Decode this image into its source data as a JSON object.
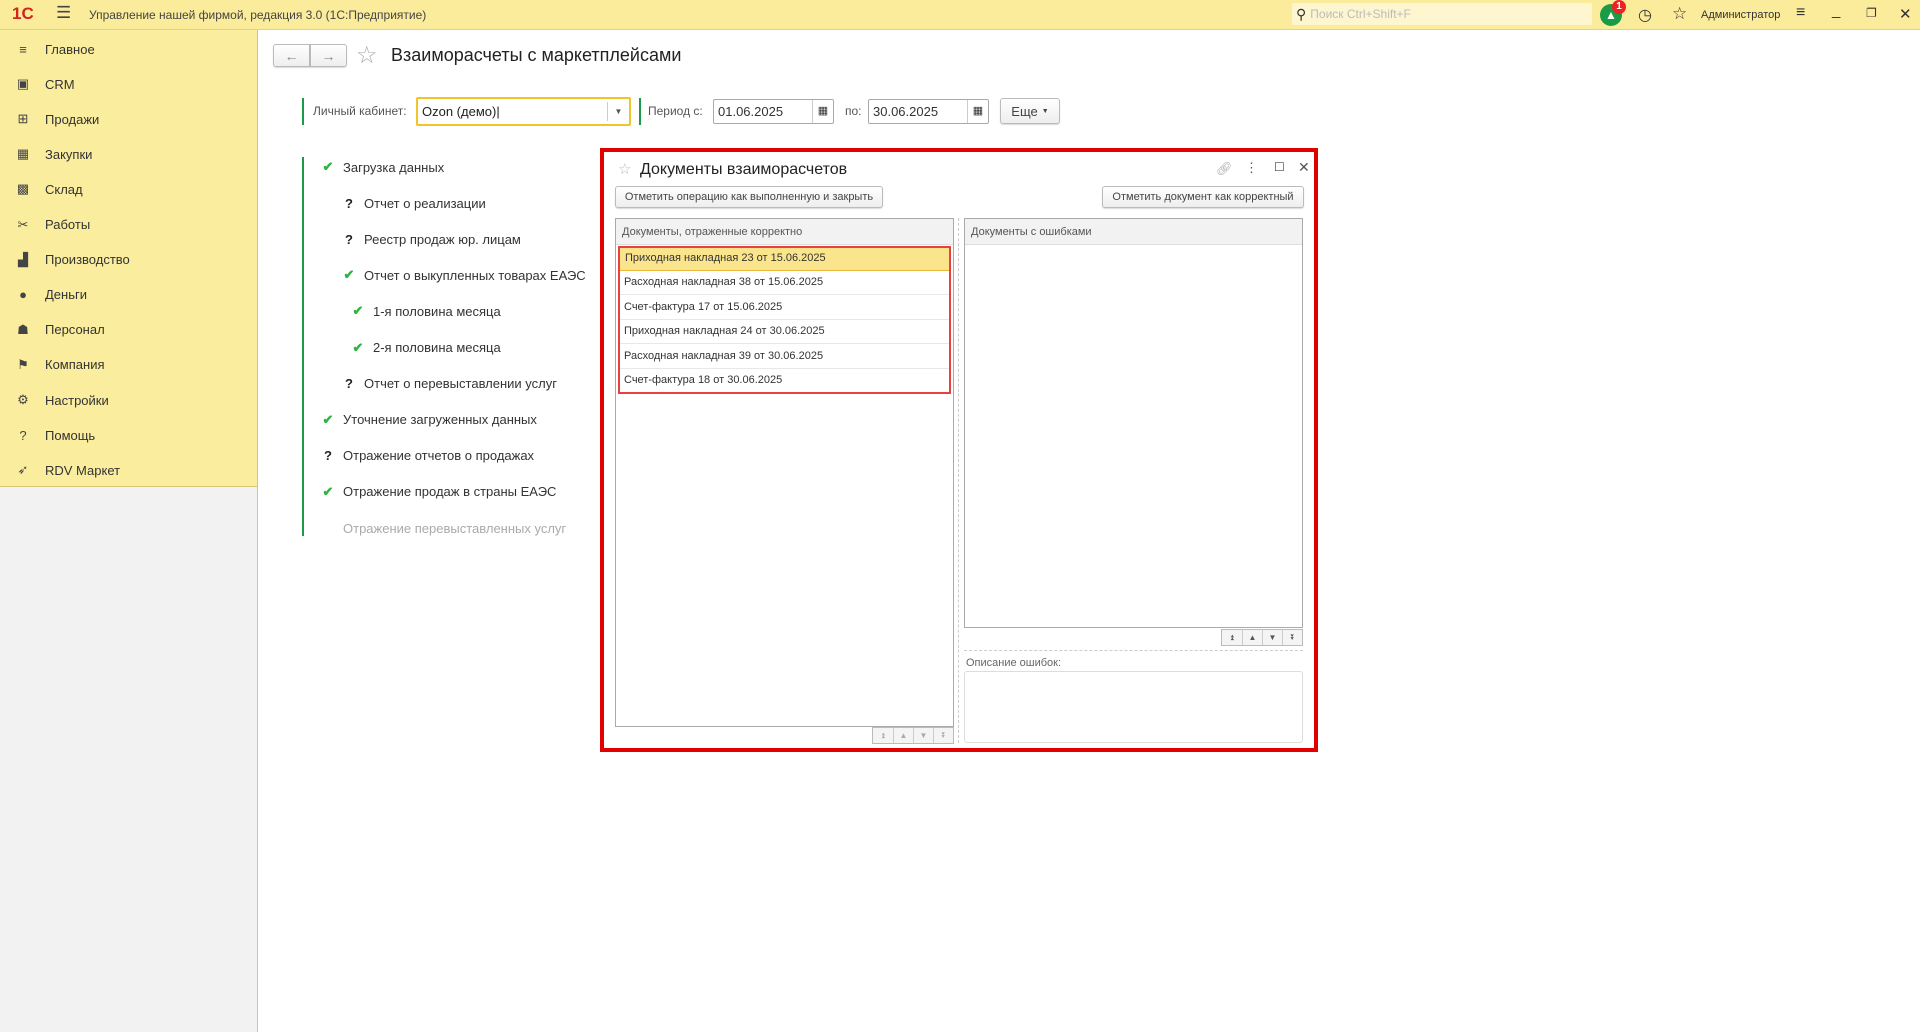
{
  "app": {
    "title": "Управление нашей фирмой, редакция 3.0  (1С:Предприятие)",
    "logo": "1С",
    "search_placeholder": "Поиск Ctrl+Shift+F",
    "notifications": "1",
    "user": "Администратор"
  },
  "sidebar": {
    "items": [
      {
        "label": "Главное",
        "icon": "menu-icon"
      },
      {
        "label": "CRM",
        "icon": "crm-icon"
      },
      {
        "label": "Продажи",
        "icon": "basket-icon"
      },
      {
        "label": "Закупки",
        "icon": "purchases-icon"
      },
      {
        "label": "Склад",
        "icon": "warehouse-icon"
      },
      {
        "label": "Работы",
        "icon": "tools-icon"
      },
      {
        "label": "Производство",
        "icon": "factory-icon"
      },
      {
        "label": "Деньги",
        "icon": "money-icon"
      },
      {
        "label": "Персонал",
        "icon": "people-icon"
      },
      {
        "label": "Компания",
        "icon": "flag-icon"
      },
      {
        "label": "Настройки",
        "icon": "gear-icon"
      },
      {
        "label": "Помощь",
        "icon": "help-icon"
      },
      {
        "label": "RDV Маркет",
        "icon": "rocket-icon"
      }
    ]
  },
  "page": {
    "title": "Взаиморасчеты с маркетплейсами",
    "cabinet_label": "Личный кабинет:",
    "cabinet_value": "Ozon (демо)",
    "period_from_label": "Период с:",
    "period_from": "01.06.2025",
    "period_to_label": "по:",
    "period_to": "30.06.2025",
    "more_label": "Еще"
  },
  "steps": [
    {
      "label": "Загрузка данных",
      "status": "done",
      "level": 0
    },
    {
      "label": "Отчет о реализации",
      "status": "unknown",
      "level": 1
    },
    {
      "label": "Реестр продаж юр. лицам",
      "status": "unknown",
      "level": 1
    },
    {
      "label": "Отчет о выкупленных товарах ЕАЭС",
      "status": "done",
      "level": 1
    },
    {
      "label": "1-я половина месяца",
      "status": "done",
      "level": 2
    },
    {
      "label": "2-я половина месяца",
      "status": "done",
      "level": 2
    },
    {
      "label": "Отчет о перевыставлении услуг",
      "status": "unknown",
      "level": 1
    },
    {
      "label": "Уточнение загруженных данных",
      "status": "done",
      "level": 0
    },
    {
      "label": "Отражение отчетов о продажах",
      "status": "unknown",
      "level": 0
    },
    {
      "label": "Отражение продаж в страны ЕАЭС",
      "status": "done",
      "level": 0
    },
    {
      "label": "Отражение перевыставленных услуг",
      "status": "disabled",
      "level": 0
    }
  ],
  "dialog": {
    "title": "Документы взаиморасчетов",
    "btn_mark_done": "Отметить операцию как выполненную и закрыть",
    "btn_mark_correct": "Отметить документ как корректный",
    "correct_header": "Документы, отраженные корректно",
    "errors_header": "Документы с ошибками",
    "errors_desc_label": "Описание ошибок:",
    "correct_docs": [
      "Приходная накладная 23 от 15.06.2025",
      "Расходная накладная 38 от 15.06.2025",
      "Счет-фактура 17 от 15.06.2025",
      "Приходная накладная 24 от 30.06.2025",
      "Расходная накладная 39 от 30.06.2025",
      "Счет-фактура 18 от 30.06.2025"
    ]
  },
  "colors": {
    "highlight": "#e00000",
    "accent_green": "#1b9b46",
    "topbar": "#fbec9c"
  }
}
